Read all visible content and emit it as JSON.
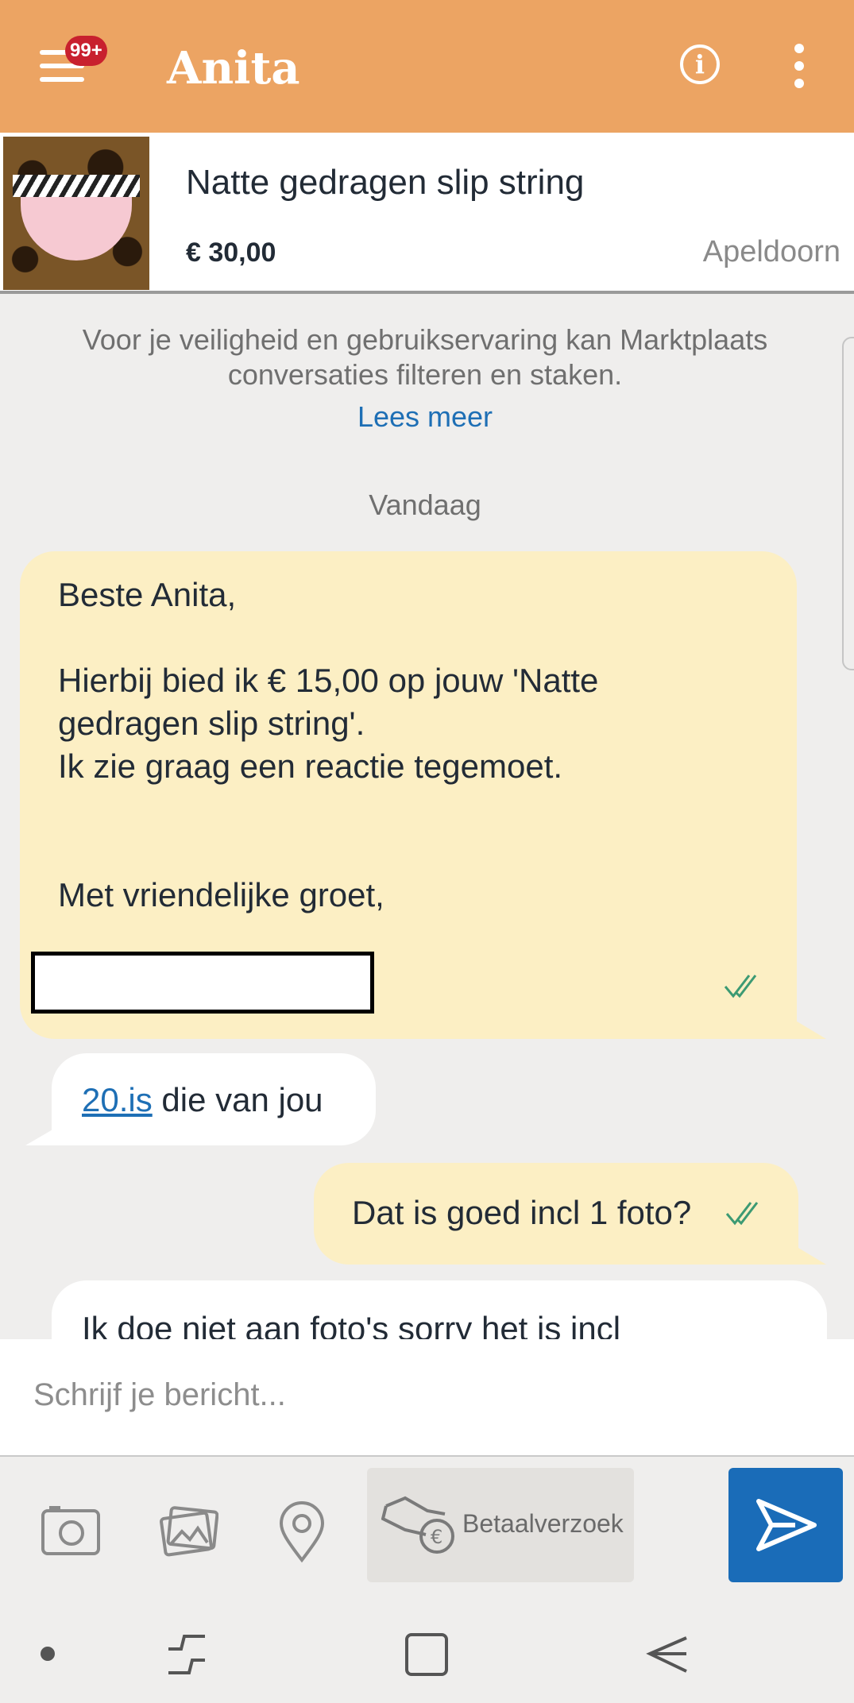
{
  "header": {
    "menu_badge": "99+",
    "contact_name": "Anita"
  },
  "listing": {
    "title": "Natte gedragen slip string",
    "price": "€ 30,00",
    "location": "Apeldoorn"
  },
  "notice": {
    "text": "Voor je veiligheid en gebruikservaring kan Marktplaats conversaties filteren en staken.",
    "link": "Lees meer"
  },
  "day_separator": "Vandaag",
  "messages": [
    {
      "direction": "outgoing",
      "text": "Beste Anita,\n\nHierbij bied ik € 15,00 op jouw 'Natte\ngedragen slip string'.\nIk zie graag een reactie tegemoet.\n\n\nMet vriendelijke groet,",
      "status": "read"
    },
    {
      "direction": "incoming",
      "link_text": "20.is",
      "text": " die van jou"
    },
    {
      "direction": "outgoing",
      "text": "Dat is goed incl 1 foto?",
      "status": "read"
    },
    {
      "direction": "incoming",
      "text": "Ik doe niet aan foto's sorry het is incl"
    }
  ],
  "composer": {
    "placeholder": "Schrijf je bericht..."
  },
  "toolbar": {
    "payment_request_label": "Betaalverzoek"
  },
  "icons": {
    "menu": "hamburger-menu-icon",
    "info": "info-icon",
    "more": "more-vertical-icon",
    "read_receipt": "double-check-icon",
    "camera": "camera-icon",
    "gallery": "gallery-icon",
    "location": "location-pin-icon",
    "payment": "hand-money-icon",
    "send": "send-icon"
  },
  "colors": {
    "header_bg": "#eca463",
    "outgoing_bubble": "#fcefc4",
    "incoming_bubble": "#ffffff",
    "link": "#1e6fb5",
    "send_button": "#1a6cb8",
    "read_tick": "#3c9a73",
    "badge": "#c8202e"
  }
}
